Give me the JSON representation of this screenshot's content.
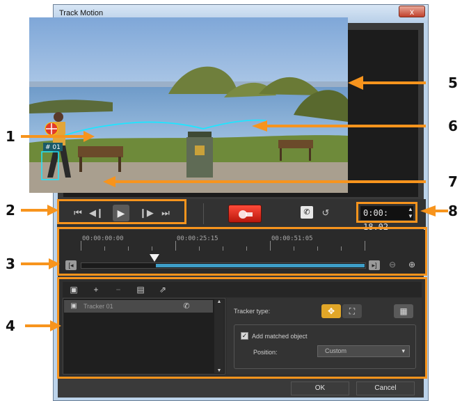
{
  "window": {
    "title": "Track Motion",
    "close_glyph": "x"
  },
  "player": {
    "timecode": "0:00: 18.02",
    "icons": [
      "go-start-icon",
      "step-back-icon",
      "play-icon",
      "step-forward-icon",
      "go-end-icon",
      "phone-icon",
      "history-icon",
      "record-icon"
    ]
  },
  "timeline": {
    "marks": [
      "00:00:00:00",
      "00:00:25:15",
      "00:00:51:05"
    ]
  },
  "tracker_panel": {
    "toolbar_icons": [
      "tracker-view-icon",
      "add-icon",
      "remove-icon",
      "preview-icon",
      "export-icon"
    ],
    "trackers": [
      {
        "label": "Tracker 01"
      }
    ],
    "tracker_type_label": "Tracker type:",
    "add_matched_label": "Add matched object",
    "add_matched_checked": true,
    "position_label": "Position:",
    "position_value": "Custom"
  },
  "overlay": {
    "tracker_tag": "# 01"
  },
  "footer": {
    "ok_label": "OK",
    "cancel_label": "Cancel"
  },
  "callouts": [
    "1",
    "2",
    "3",
    "4",
    "5",
    "6",
    "7",
    "8"
  ],
  "colors": {
    "annotation_orange": "#f7941d",
    "track_path_cyan": "#1fe5ff",
    "record_red": "#e4271a"
  }
}
